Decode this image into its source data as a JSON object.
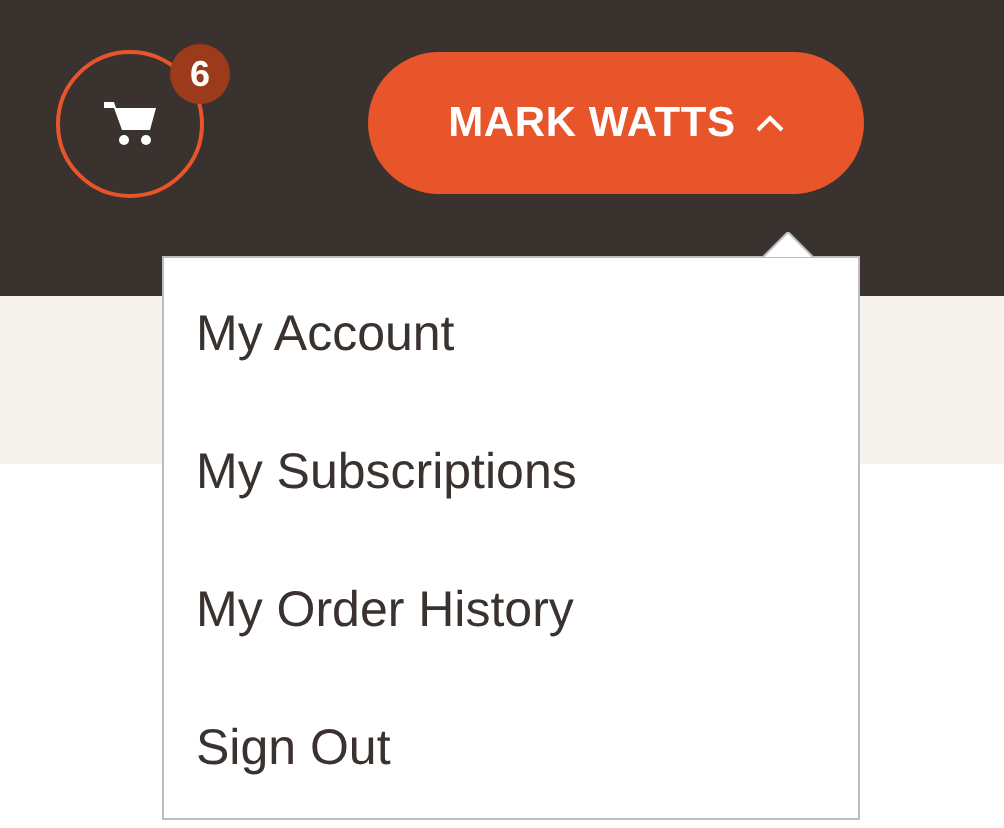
{
  "cart": {
    "count": "6"
  },
  "user_menu": {
    "label": "MARK WATTS",
    "expanded": true,
    "items": [
      {
        "label": "My Account"
      },
      {
        "label": "My Subscriptions"
      },
      {
        "label": "My Order History"
      },
      {
        "label": "Sign Out"
      }
    ]
  }
}
